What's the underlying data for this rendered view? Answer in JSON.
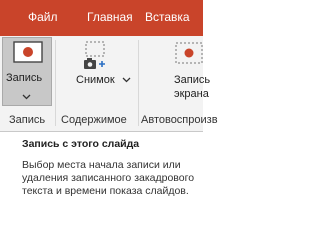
{
  "tabs": [
    "Файл",
    "Главная",
    "Вставка"
  ],
  "ribbon": {
    "record_button": {
      "label": "Запись",
      "icon": "record-screen-icon"
    },
    "snapshot_button": {
      "label": "Снимок",
      "icon": "camera-add-icon"
    },
    "screen_record_button": {
      "label_line1": "Запись",
      "label_line2": "экрана",
      "icon": "screen-record-icon"
    },
    "groups": [
      "Запись",
      "Содержимое",
      "Автовоспроизв"
    ]
  },
  "tooltip": {
    "title": "Запись с этого слайда",
    "body": "Выбор места начала записи или удаления записанного закадрового текста и времени показа слайдов."
  },
  "colors": {
    "tabbar": "#c9442a",
    "record_accent": "#c9442a",
    "icon_gray": "#444444"
  }
}
